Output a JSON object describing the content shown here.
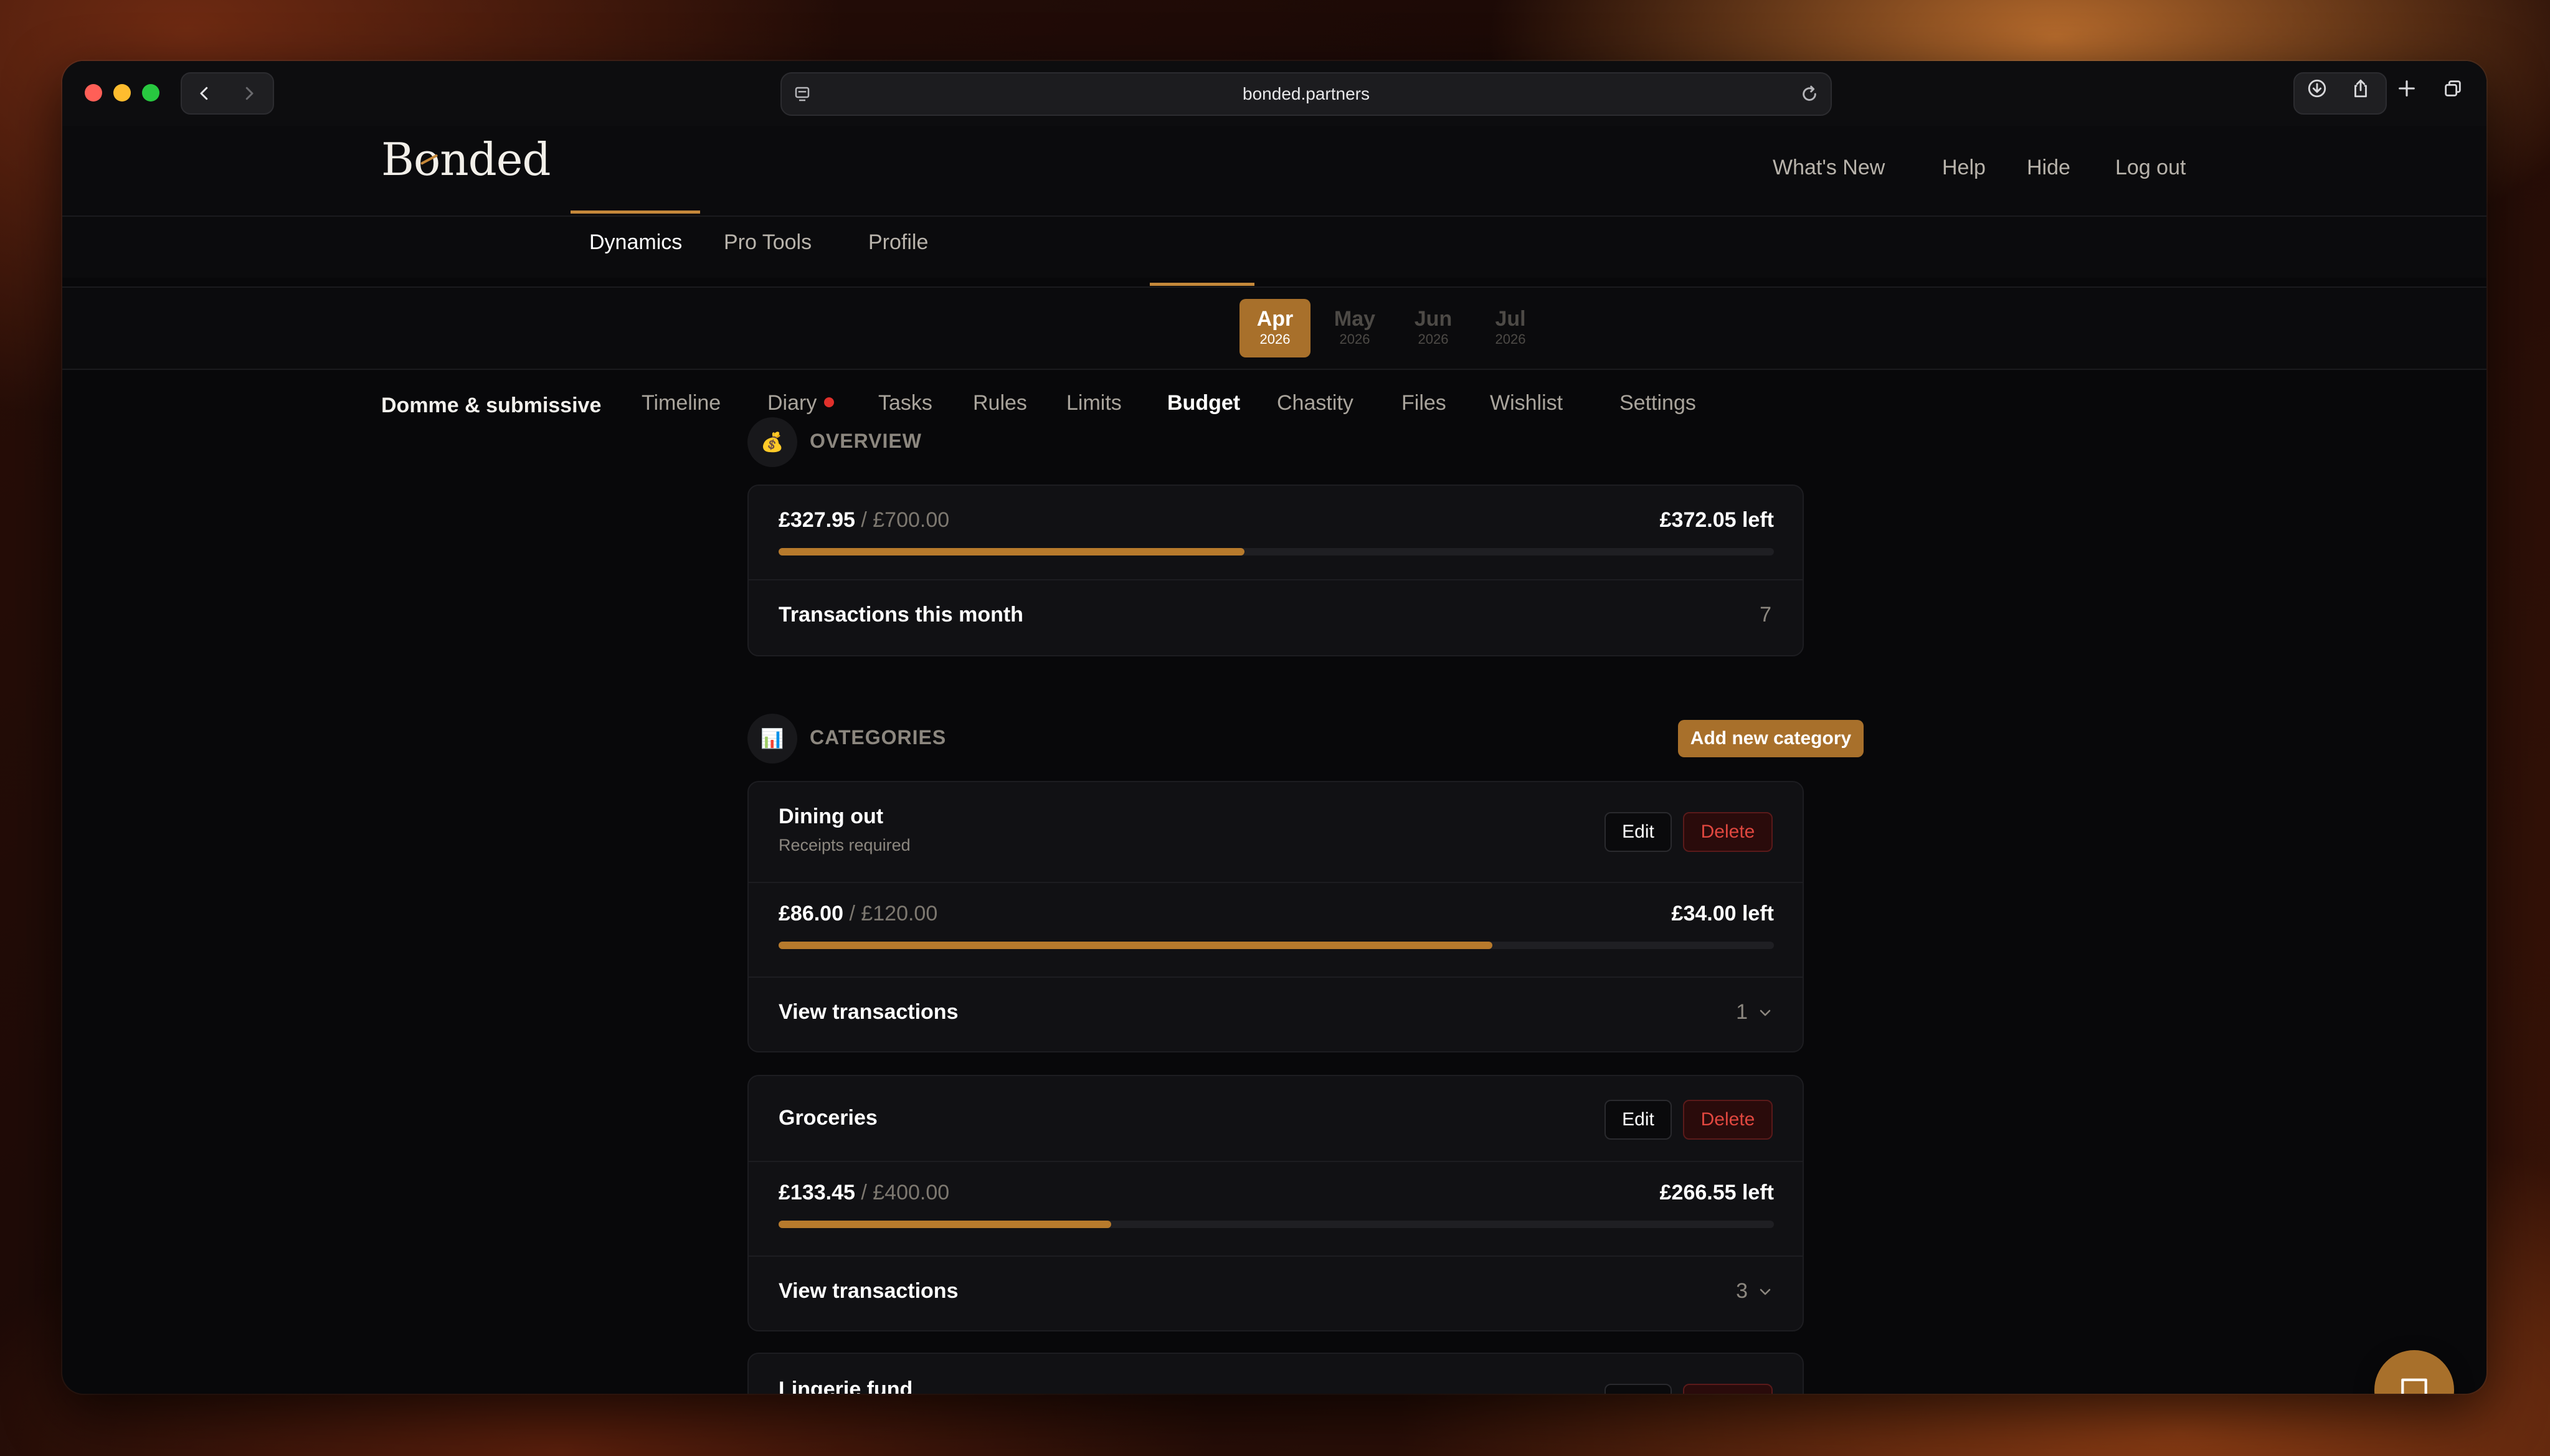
{
  "browser": {
    "url": "bonded.partners"
  },
  "app": {
    "logo": "Bonded",
    "main_nav": [
      "Dynamics",
      "Pro Tools",
      "Profile"
    ],
    "top_right": [
      "What's New",
      "Help",
      "Hide",
      "Log out"
    ],
    "dynamic_name": "Domme & submissive",
    "sub_nav": [
      "Timeline",
      "Diary",
      "Tasks",
      "Rules",
      "Limits",
      "Budget",
      "Chastity",
      "Files",
      "Wishlist",
      "Settings"
    ],
    "active_main": "Dynamics",
    "active_sub": "Budget"
  },
  "months": [
    {
      "m": "Apr",
      "y": "2026",
      "active": true
    },
    {
      "m": "May",
      "y": "2026"
    },
    {
      "m": "Jun",
      "y": "2026"
    },
    {
      "m": "Jul",
      "y": "2026"
    }
  ],
  "overview": {
    "icon": "money-bag-icon",
    "title": "OVERVIEW",
    "spent": "£327.95",
    "total": "/ £700.00",
    "left": "£372.05 left",
    "progress": 0.468,
    "transactions_label": "Transactions this month",
    "transactions_count": "7"
  },
  "categories": {
    "icon": "bar-chart-icon",
    "title": "CATEGORIES",
    "add_label": "Add new category",
    "edit_label": "Edit",
    "delete_label": "Delete",
    "view_label": "View transactions",
    "items": [
      {
        "name": "Dining out",
        "sub": "Receipts required",
        "spent": "£86.00",
        "total": "/ £120.00",
        "left": "£34.00 left",
        "progress": 0.717,
        "count": "1"
      },
      {
        "name": "Groceries",
        "sub": "",
        "spent": "£133.45",
        "total": "/ £400.00",
        "left": "£266.55 left",
        "progress": 0.334,
        "count": "3"
      },
      {
        "name": "Lingerie fund",
        "sub": "",
        "spent": "",
        "total": "",
        "left": "",
        "count": ""
      }
    ]
  },
  "colors": {
    "accent": "#b77a2c",
    "danger": "#e0473f",
    "background": "#08080a"
  }
}
